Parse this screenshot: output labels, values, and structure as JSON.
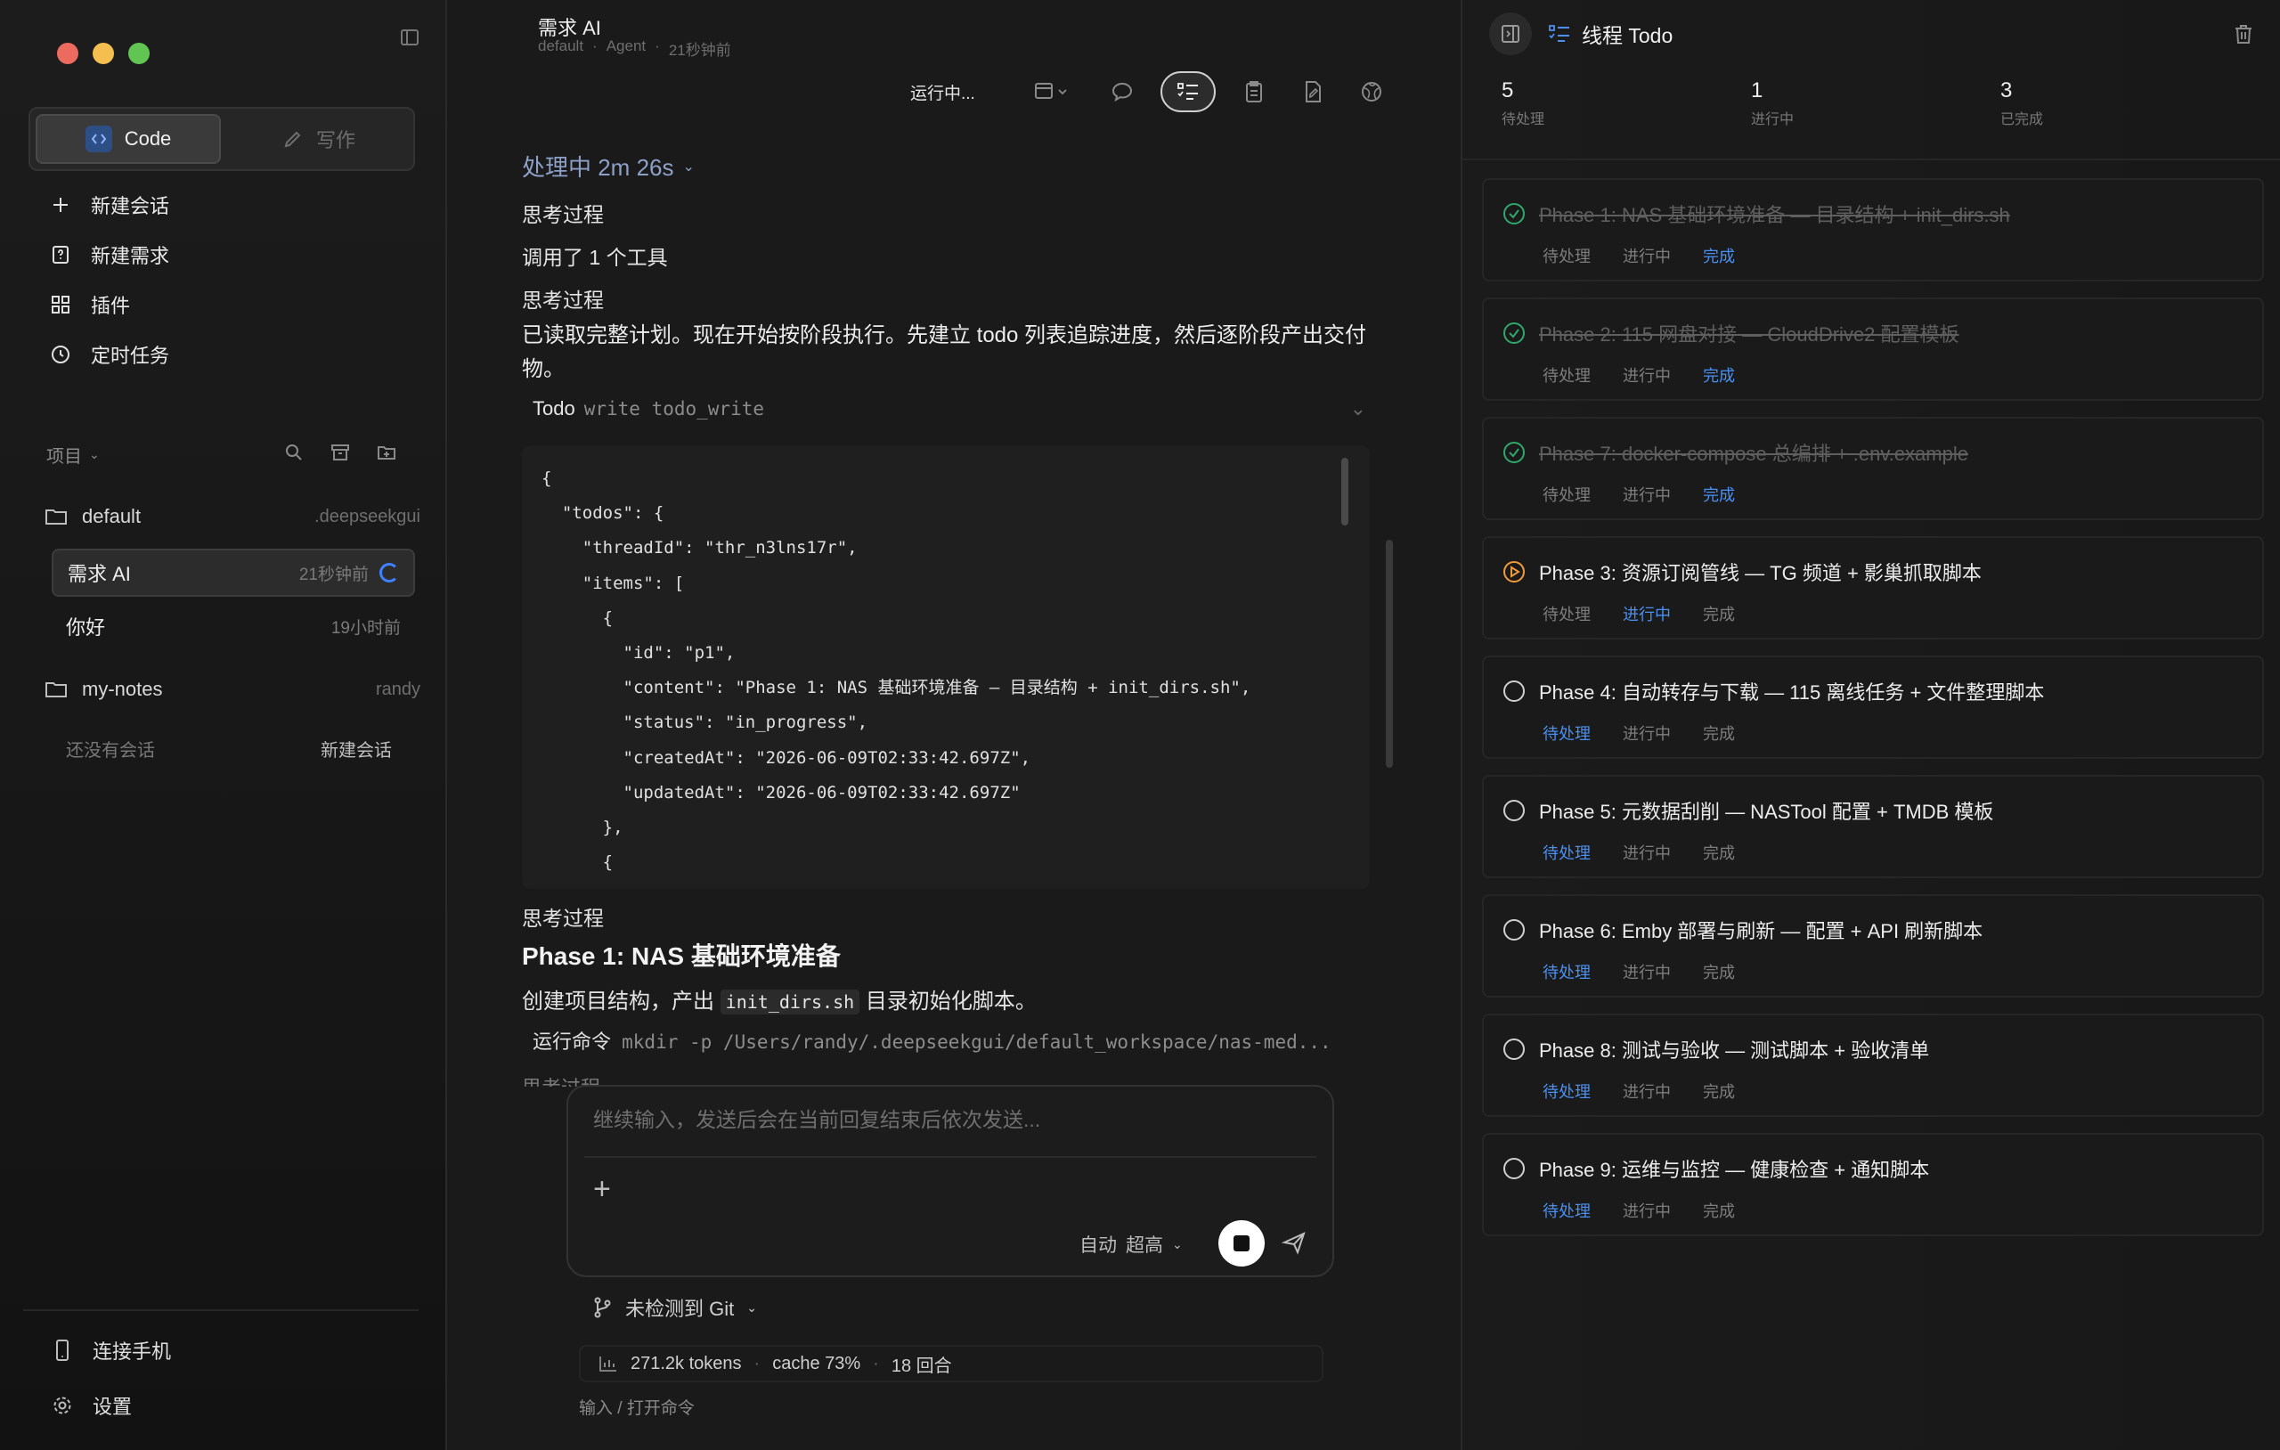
{
  "sidebar": {
    "modes": {
      "code": "Code",
      "write": "写作"
    },
    "nav": [
      {
        "label": "新建会话",
        "icon": "plus-icon"
      },
      {
        "label": "新建需求",
        "icon": "question-doc-icon"
      },
      {
        "label": "插件",
        "icon": "grid-icon"
      },
      {
        "label": "定时任务",
        "icon": "clock-icon"
      }
    ],
    "projects_label": "项目",
    "projects": [
      {
        "name": "default",
        "meta": ".deepseekgui"
      },
      {
        "name": "my-notes",
        "meta": "randy"
      }
    ],
    "sessions": [
      {
        "name": "需求 AI",
        "time": "21秒钟前",
        "active": true
      },
      {
        "name": "你好",
        "time": "19小时前",
        "active": false
      }
    ],
    "empty_text": "还没有会话",
    "empty_new": "新建会话",
    "footer": {
      "phone": "连接手机",
      "settings": "设置"
    }
  },
  "main": {
    "title": "需求 AI",
    "sub": {
      "project": "default",
      "sep": "·",
      "type": "Agent",
      "time": "21秒钟前"
    },
    "status": "运行中...",
    "processing": "处理中 2m 26s",
    "think1": "思考过程",
    "tool_call": "调用了 1 个工具",
    "think2": "思考过程",
    "message": "已读取完整计划。现在开始按阶段执行。先建立 todo 列表追踪进度，然后逐阶段产出交付物。",
    "todo_tool": {
      "name": "Todo",
      "cmd": "write todo_write"
    },
    "code": "{\n  \"todos\": {\n    \"threadId\": \"thr_n3lns17r\",\n    \"items\": [\n      {\n        \"id\": \"p1\",\n        \"content\": \"Phase 1: NAS 基础环境准备 — 目录结构 + init_dirs.sh\",\n        \"status\": \"in_progress\",\n        \"createdAt\": \"2026-06-09T02:33:42.697Z\",\n        \"updatedAt\": \"2026-06-09T02:33:42.697Z\"\n      },\n      {",
    "think3": "思考过程",
    "heading": "Phase 1: NAS 基础环境准备",
    "desc_pre": "创建项目结构，产出",
    "desc_code": "init_dirs.sh",
    "desc_post": "目录初始化脚本。",
    "run_label": "运行命令",
    "run_cmd": "mkdir -p /Users/randy/.deepseekgui/default_workspace/nas-med...",
    "fade": "思考过程",
    "composer": {
      "placeholder": "继续输入，发送后会在当前回复结束后依次发送...",
      "mode": "自动",
      "level": "超高"
    },
    "git": "未检测到 Git",
    "stats": {
      "tokens": "271.2k tokens",
      "cache": "cache 73%",
      "rounds": "18 回合"
    },
    "cmd_hint": "输入 / 打开命令"
  },
  "todo_panel": {
    "title": "线程 Todo",
    "stats": [
      {
        "num": "5",
        "label": "待处理"
      },
      {
        "num": "1",
        "label": "进行中"
      },
      {
        "num": "3",
        "label": "已完成"
      }
    ],
    "state_labels": [
      "待处理",
      "进行中",
      "完成"
    ],
    "tasks": [
      {
        "title": "Phase 1: NAS 基础环境准备 — 目录结构 + init_dirs.sh",
        "status": "done"
      },
      {
        "title": "Phase 2: 115 网盘对接 — CloudDrive2 配置模板",
        "status": "done"
      },
      {
        "title": "Phase 7: docker-compose 总编排 + .env.example",
        "status": "done"
      },
      {
        "title": "Phase 3: 资源订阅管线 — TG 频道 + 影巢抓取脚本",
        "status": "in_progress"
      },
      {
        "title": "Phase 4: 自动转存与下载 — 115 离线任务 + 文件整理脚本",
        "status": "pending"
      },
      {
        "title": "Phase 5: 元数据刮削 — NASTool 配置 + TMDB 模板",
        "status": "pending"
      },
      {
        "title": "Phase 6: Emby 部署与刷新 — 配置 + API 刷新脚本",
        "status": "pending"
      },
      {
        "title": "Phase 8: 测试与验收 — 测试脚本 + 验收清单",
        "status": "pending"
      },
      {
        "title": "Phase 9: 运维与监控 — 健康检查 + 通知脚本",
        "status": "pending"
      }
    ]
  },
  "colors": {
    "accent": "#4a90f0",
    "done": "#2fa86b",
    "progress": "#f09a3a"
  }
}
